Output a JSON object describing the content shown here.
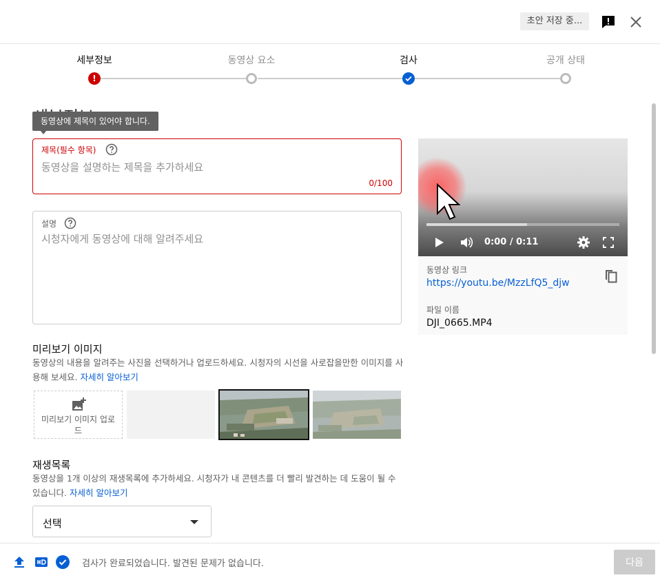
{
  "header": {
    "draft_status": "초안 저장 중...",
    "feedback_icon": "feedback-icon",
    "close_icon": "close-icon"
  },
  "stepper": {
    "steps": [
      {
        "label": "세부정보",
        "state": "error"
      },
      {
        "label": "동영상 요소",
        "state": "pending"
      },
      {
        "label": "검사",
        "state": "done"
      },
      {
        "label": "공개 상태",
        "state": "pending"
      }
    ]
  },
  "details": {
    "section_title": "세부정보",
    "tooltip": "동영상에 제목이 있어야 합니다.",
    "title_field": {
      "label": "제목(필수 항목)",
      "placeholder": "동영상을 설명하는 제목을 추가하세요",
      "value": "",
      "counter": "0/100"
    },
    "description_field": {
      "label": "설명",
      "placeholder": "시청자에게 동영상에 대해 알려주세요",
      "value": ""
    }
  },
  "thumbnail": {
    "title": "미리보기 이미지",
    "description": "동영상의 내용을 알려주는 사진을 선택하거나 업로드하세요. 시청자의 시선을 사로잡을만한 이미지를 사용해 보세요.",
    "learn_more": "자세히 알아보기",
    "upload_label": "미리보기 이미지 업로드"
  },
  "playlist": {
    "title": "재생목록",
    "description": "동영상을 1개 이상의 재생목록에 추가하세요. 시청자가 내 콘텐츠를 더 빨리 발견하는 데 도움이 될 수 있습니다.",
    "learn_more": "자세히 알아보기",
    "select_value": "선택"
  },
  "video": {
    "time": "0:00 / 0:11",
    "progress": 0.52,
    "link_label": "동영상 링크",
    "link": "https://youtu.be/MzzLfQ5_djw",
    "filename_label": "파일 이름",
    "filename": "DJI_0665.MP4"
  },
  "footer": {
    "status": "검사가 완료되었습니다. 발견된 문제가 없습니다.",
    "next_label": "다음"
  },
  "colors": {
    "error": "#cc0000",
    "accent": "#065fd4",
    "disabled": "#cccccc"
  }
}
